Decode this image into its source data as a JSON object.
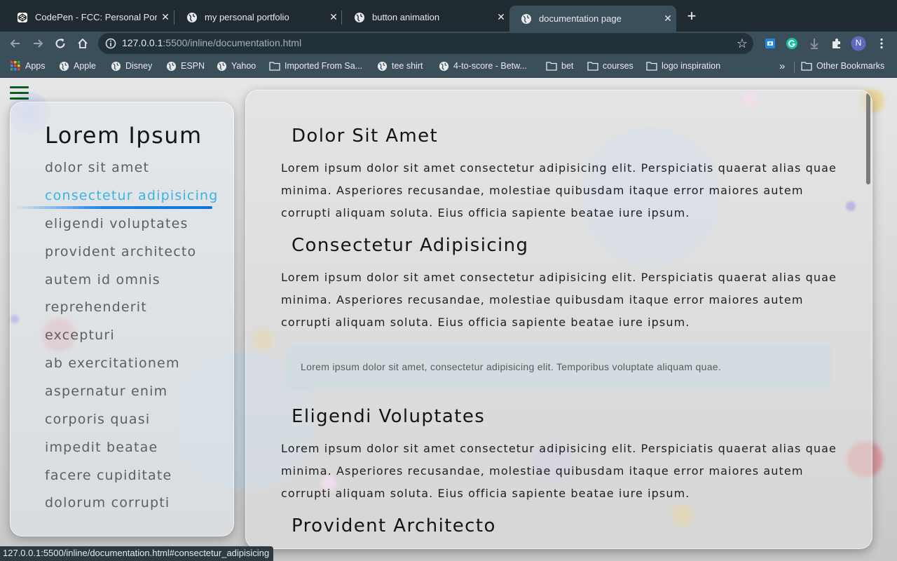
{
  "browser": {
    "tabs": [
      {
        "title": "CodePen - FCC: Personal Portf",
        "icon": "codepen-icon",
        "active": false
      },
      {
        "title": "my personal portfolio",
        "icon": "globe-icon",
        "active": false
      },
      {
        "title": "button animation",
        "icon": "globe-icon",
        "active": false
      },
      {
        "title": "documentation page",
        "icon": "globe-icon",
        "active": true
      }
    ],
    "close_glyph": "✕",
    "new_tab_glyph": "+",
    "url_host": "127.0.0.1",
    "url_rest": ":5500/inline/documentation.html",
    "bookmarks": [
      {
        "label": "Apps",
        "icon": "apps-grid-icon"
      },
      {
        "label": "Apple",
        "icon": "globe-icon"
      },
      {
        "label": "Disney",
        "icon": "globe-icon"
      },
      {
        "label": "ESPN",
        "icon": "globe-icon"
      },
      {
        "label": "Yahoo",
        "icon": "globe-icon"
      },
      {
        "label": "Imported From Sa...",
        "icon": "folder-icon"
      },
      {
        "label": "tee shirt",
        "icon": "globe-icon"
      },
      {
        "label": "4-to-score - Betw...",
        "icon": "globe-icon"
      },
      {
        "label": "bet",
        "icon": "folder-icon"
      },
      {
        "label": "courses",
        "icon": "folder-icon"
      },
      {
        "label": "logo inspiration",
        "icon": "folder-icon"
      }
    ],
    "overflow_glyph": "»",
    "other_bookmarks": "Other Bookmarks",
    "profile_initial": "N",
    "status_url": "127.0.0.1:5500/inline/documentation.html#consectetur_adipisicing"
  },
  "sidebar": {
    "title": "Lorem Ipsum",
    "links": [
      {
        "label": "dolor sit amet",
        "active": false
      },
      {
        "label": "consectetur adipisicing",
        "active": true
      },
      {
        "label": "eligendi voluptates",
        "active": false
      },
      {
        "label": "provident architecto",
        "active": false
      },
      {
        "label": "autem id omnis",
        "active": false
      },
      {
        "label": "reprehenderit",
        "active": false
      },
      {
        "label": "excepturi",
        "active": false
      },
      {
        "label": "ab exercitationem",
        "active": false
      },
      {
        "label": "aspernatur enim",
        "active": false
      },
      {
        "label": "corporis quasi",
        "active": false
      },
      {
        "label": "impedit beatae",
        "active": false
      },
      {
        "label": "facere cupiditate",
        "active": false
      },
      {
        "label": "dolorum corrupti",
        "active": false
      }
    ]
  },
  "main": {
    "sections": [
      {
        "title": "Dolor Sit Amet",
        "text": "Lorem ipsum dolor sit amet consectetur adipisicing elit. Perspiciatis quaerat alias quae minima. Asperiores recusandae, molestiae quibusdam itaque error maiores autem corrupti aliquam soluta. Eius officia sapiente beatae iure ipsum."
      },
      {
        "title": "Consectetur Adipisicing",
        "text": "Lorem ipsum dolor sit amet consectetur adipisicing elit. Perspiciatis quaerat alias quae minima. Asperiores recusandae, molestiae quibusdam itaque error maiores autem corrupti aliquam soluta. Eius officia sapiente beatae iure ipsum."
      },
      {
        "title": "Eligendi Voluptates",
        "text": "Lorem ipsum dolor sit amet consectetur adipisicing elit. Perspiciatis quaerat alias quae minima. Asperiores recusandae, molestiae quibusdam itaque error maiores autem corrupti aliquam soluta. Eius officia sapiente beatae iure ipsum."
      },
      {
        "title": "Provident Architecto",
        "text": ""
      }
    ],
    "note": "Lorem ipsum dolor sit amet, consectetur adipisicing elit. Temporibus voluptate aliquam quae."
  },
  "colors": {
    "tabbar_bg": "#1f2a31",
    "toolbar_bg": "#3b4f5a",
    "active_link": "#38b4e8",
    "underline": "#1a84ea",
    "hamburger": "#0a5c20"
  }
}
